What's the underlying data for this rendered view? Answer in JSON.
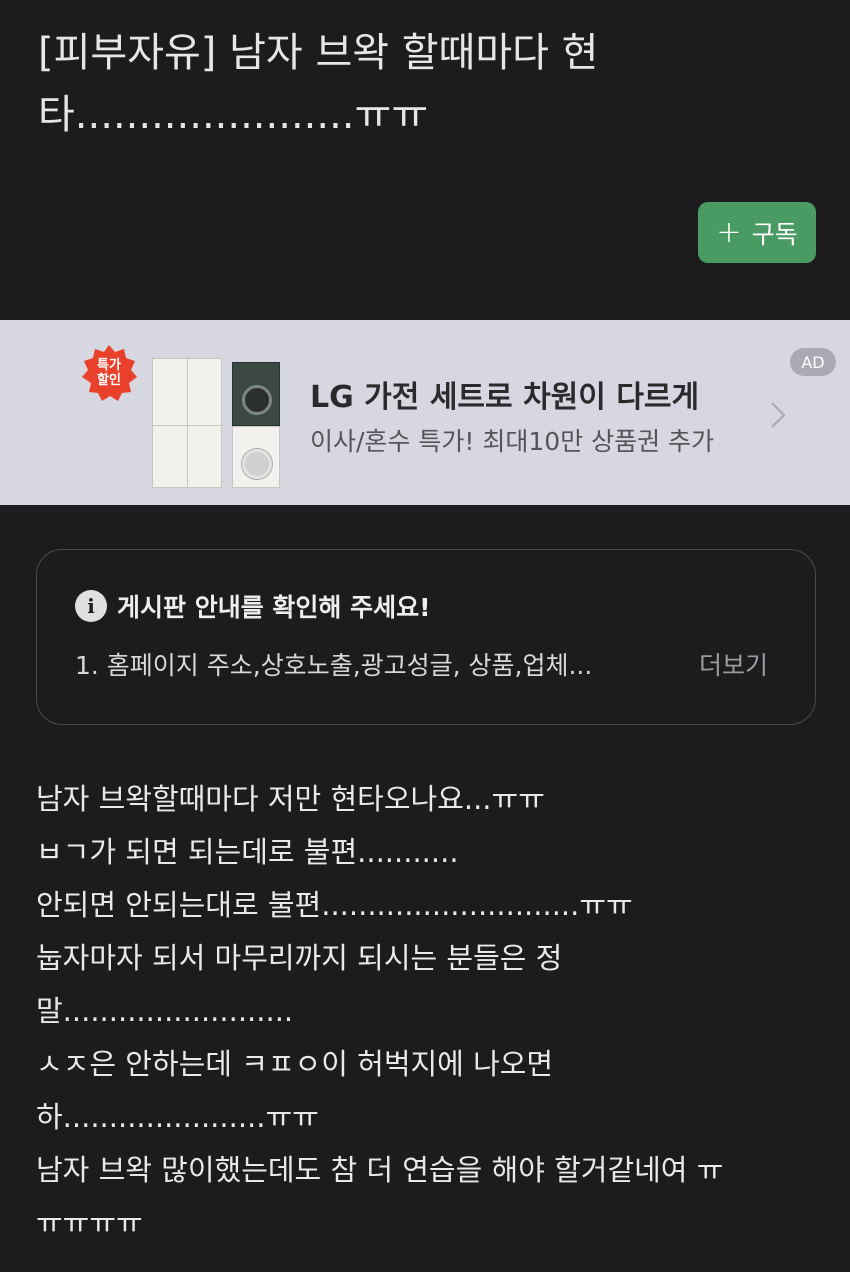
{
  "post": {
    "title_line1": "[피부자유] 남자 브왁 할때마다 현",
    "title_line2": "타......................ㅠㅠ",
    "subscribe_label": "구독"
  },
  "ad": {
    "badge_line1": "특가",
    "badge_line2": "할인",
    "title": "LG 가전 세트로 차원이 다르게",
    "subtitle": "이사/혼수 특가! 최대10만 상품권 추가",
    "tag": "AD"
  },
  "notice": {
    "title": "게시판 안내를 확인해 주세요!",
    "body": "1. 홈페이지 주소,상호노출,광고성글, 상품,업체...",
    "more_label": "더보기"
  },
  "content": {
    "lines": [
      "남자 브왁할때마다 저만 현타오나요...ㅠㅠ",
      "ㅂㄱ가 되면 되는데로 불편...........",
      "안되면 안되는대로 불편............................ㅠㅠ",
      "눕자마자 되서 마무리까지 되시는 분들은 정",
      "말.........................",
      "ㅅㅈ은 안하는데 ㅋㅍㅇ이 허벅지에 나오면",
      "하......................ㅠㅠ",
      "남자 브왁 많이했는데도 참 더 연습을 해야 할거같네여 ㅠ",
      "ㅠㅠㅠㅠ"
    ]
  },
  "colors": {
    "background": "#1c1c1e",
    "subscribe": "#4a9a63",
    "ad_background": "#d6d7e0",
    "badge": "#e8402a"
  }
}
